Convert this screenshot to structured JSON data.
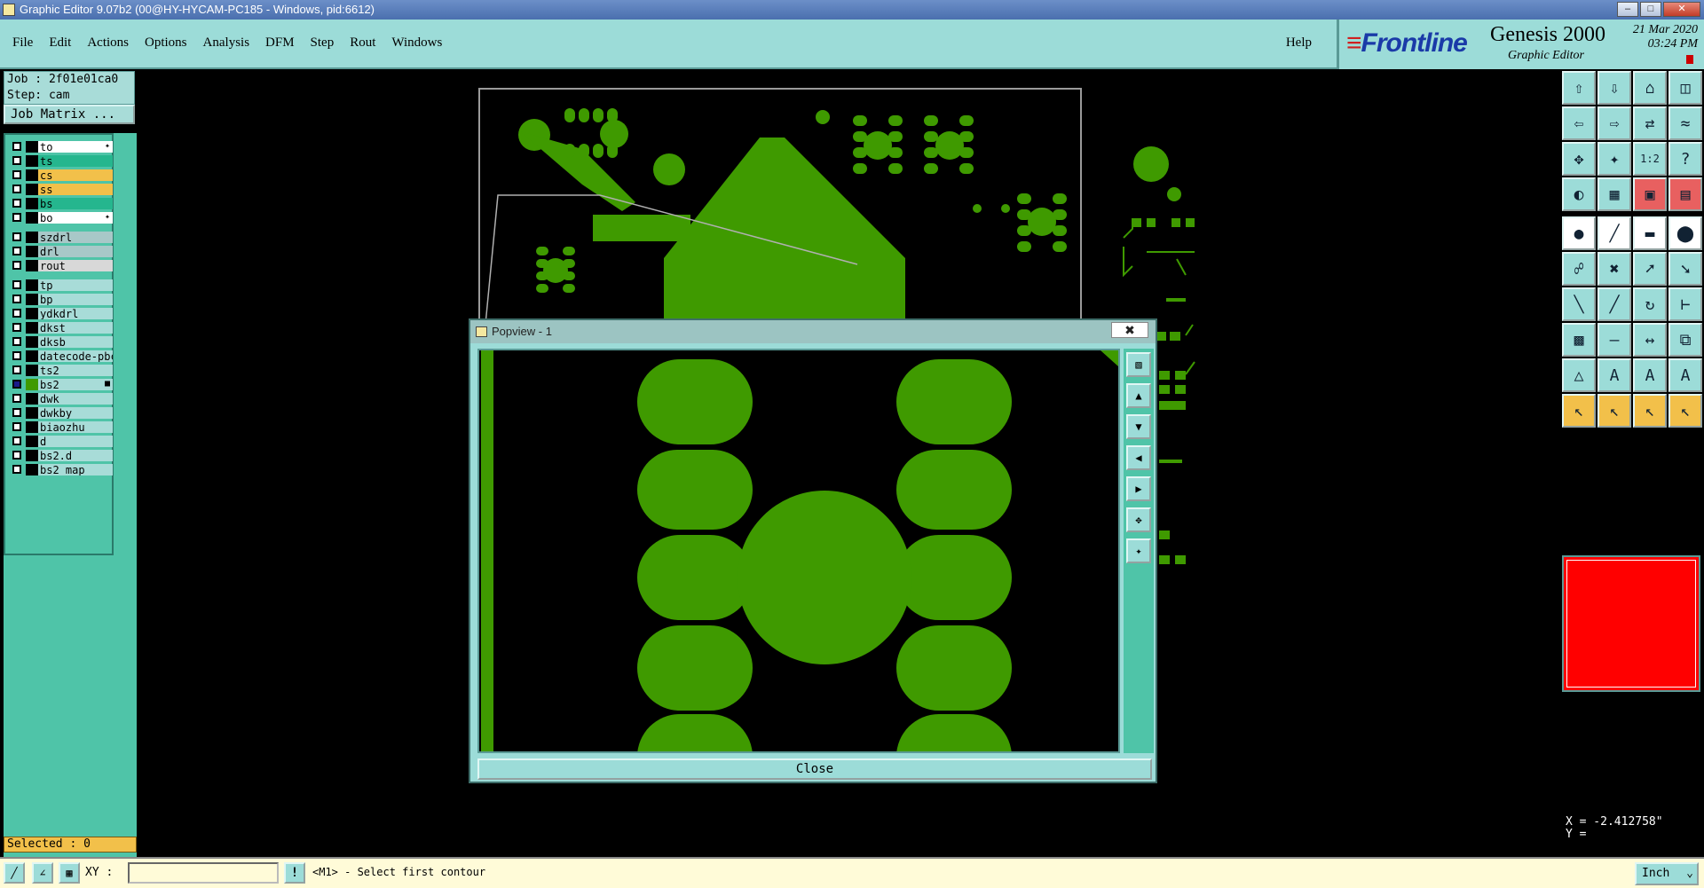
{
  "window": {
    "title": "Graphic Editor 9.07b2 (00@HY-HYCAM-PC185 - Windows, pid:6612)"
  },
  "menu": {
    "items": [
      "File",
      "Edit",
      "Actions",
      "Options",
      "Analysis",
      "DFM",
      "Step",
      "Rout",
      "Windows"
    ],
    "help": "Help"
  },
  "brand": {
    "logo": "Frontline",
    "product": "Genesis 2000",
    "subtitle": "Graphic Editor",
    "date": "21 Mar 2020",
    "time": "03:24 PM"
  },
  "job": {
    "job_line": "Job : 2f01e01ca0",
    "step_line": "Step: cam",
    "matrix_button": "Job Matrix ..."
  },
  "layers": {
    "group1": [
      {
        "name": "to",
        "color": "#ffffff",
        "icon": "✦"
      },
      {
        "name": "ts",
        "color": "#25b68e"
      },
      {
        "name": "cs",
        "color": "#f2c04a"
      },
      {
        "name": "ss",
        "color": "#f2c04a"
      },
      {
        "name": "bs",
        "color": "#25b68e"
      },
      {
        "name": "bo",
        "color": "#ffffff",
        "icon": "✦"
      }
    ],
    "group2": [
      {
        "name": "szdrl",
        "color": "#a8c8c8"
      },
      {
        "name": "drl",
        "color": "#a8c8c8"
      },
      {
        "name": "rout",
        "color": "#d8d8d8"
      }
    ],
    "group3": [
      {
        "name": "tp",
        "color": "#a8dcd8"
      },
      {
        "name": "bp",
        "color": "#a8dcd8"
      },
      {
        "name": "ydkdrl",
        "color": "#a8dcd8"
      },
      {
        "name": "dkst",
        "color": "#a8dcd8"
      },
      {
        "name": "dksb",
        "color": "#a8dcd8"
      },
      {
        "name": "datecode-pbc",
        "color": "#a8dcd8"
      },
      {
        "name": "ts2",
        "color": "#a8dcd8"
      },
      {
        "name": "bs2",
        "color": "#a8dcd8",
        "active": true,
        "icon": "■"
      },
      {
        "name": "dwk",
        "color": "#a8dcd8"
      },
      {
        "name": "dwkby",
        "color": "#a8dcd8"
      },
      {
        "name": "biaozhu",
        "color": "#a8dcd8"
      },
      {
        "name": "d",
        "color": "#a8dcd8"
      },
      {
        "name": "bs2.d",
        "color": "#a8dcd8"
      },
      {
        "name": "bs2_map",
        "color": "#a8dcd8"
      }
    ]
  },
  "selected": "Selected : 0",
  "popview": {
    "title": "Popview - 1",
    "close_x": "✖",
    "close_button": "Close"
  },
  "coords": {
    "x": "X = -2.412758\"",
    "y": "Y ="
  },
  "status": {
    "xy_label": "XY :",
    "input_value": "",
    "warn": "!",
    "message": "<M1> - Select first contour",
    "units": "Inch"
  },
  "colors": {
    "copper": "#3f9a00",
    "panel": "#9cdcd8",
    "accent": "#4fc4a8"
  }
}
